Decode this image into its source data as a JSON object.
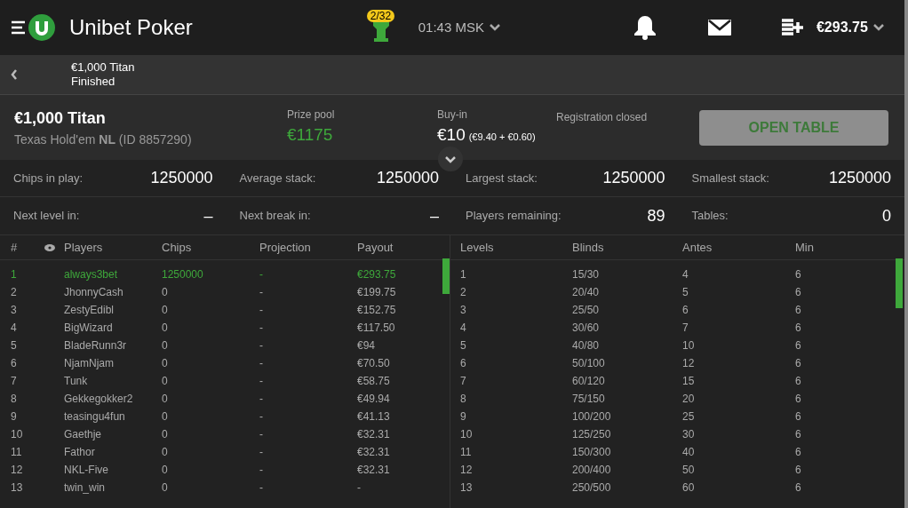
{
  "header": {
    "brand": "Unibet Poker",
    "badge": "2/32",
    "time": "01:43 MSK",
    "balance": "€293.75"
  },
  "subheader": {
    "title": "€1,000 Titan",
    "status": "Finished"
  },
  "tournament": {
    "name": "€1,000 Titan",
    "game": "Texas Hold'em **NL** (ID 8857290)",
    "prize_label": "Prize pool",
    "prize": "€1175",
    "buyin_label": "Buy-in",
    "buyin": "€10",
    "buyin_split": "(€9.40 + €0.60)",
    "registration": "Registration closed",
    "button": "OPEN TABLE"
  },
  "stats": [
    {
      "label": "Chips in play:",
      "value": "1250000"
    },
    {
      "label": "Average stack:",
      "value": "1250000"
    },
    {
      "label": "Largest stack:",
      "value": "1250000"
    },
    {
      "label": "Smallest stack:",
      "value": "1250000"
    },
    {
      "label": "Next level in:",
      "value": "–"
    },
    {
      "label": "Next break in:",
      "value": "–"
    },
    {
      "label": "Players remaining:",
      "value": "89"
    },
    {
      "label": "Tables:",
      "value": "0"
    }
  ],
  "players": {
    "columns": [
      "#",
      "Players",
      "Chips",
      "Projection",
      "Payout"
    ],
    "rows": [
      {
        "rank": "1",
        "name": "always3bet",
        "chips": "1250000",
        "projection": "-",
        "payout": "€293.75",
        "highlighted": true
      },
      {
        "rank": "2",
        "name": "JhonnyCash",
        "chips": "0",
        "projection": "-",
        "payout": "€199.75",
        "highlighted": false
      },
      {
        "rank": "3",
        "name": "ZestyEdibl",
        "chips": "0",
        "projection": "-",
        "payout": "€152.75",
        "highlighted": false
      },
      {
        "rank": "4",
        "name": "BigWizard",
        "chips": "0",
        "projection": "-",
        "payout": "€117.50",
        "highlighted": false
      },
      {
        "rank": "5",
        "name": "BladeRunn3r",
        "chips": "0",
        "projection": "-",
        "payout": "€94",
        "highlighted": false
      },
      {
        "rank": "6",
        "name": "NjamNjam",
        "chips": "0",
        "projection": "-",
        "payout": "€70.50",
        "highlighted": false
      },
      {
        "rank": "7",
        "name": "Tunk",
        "chips": "0",
        "projection": "-",
        "payout": "€58.75",
        "highlighted": false
      },
      {
        "rank": "8",
        "name": "Gekkegokker2",
        "chips": "0",
        "projection": "-",
        "payout": "€49.94",
        "highlighted": false
      },
      {
        "rank": "9",
        "name": "teasingu4fun",
        "chips": "0",
        "projection": "-",
        "payout": "€41.13",
        "highlighted": false
      },
      {
        "rank": "10",
        "name": "Gaethje",
        "chips": "0",
        "projection": "-",
        "payout": "€32.31",
        "highlighted": false
      },
      {
        "rank": "11",
        "name": "Fathor",
        "chips": "0",
        "projection": "-",
        "payout": "€32.31",
        "highlighted": false
      },
      {
        "rank": "12",
        "name": "NKL-Five",
        "chips": "0",
        "projection": "-",
        "payout": "€32.31",
        "highlighted": false
      },
      {
        "rank": "13",
        "name": "twin_win",
        "chips": "0",
        "projection": "-",
        "payout": "-",
        "highlighted": false
      }
    ]
  },
  "levels": {
    "columns": [
      "Levels",
      "Blinds",
      "Antes",
      "Min"
    ],
    "rows": [
      [
        "1",
        "15/30",
        "4",
        "6"
      ],
      [
        "2",
        "20/40",
        "5",
        "6"
      ],
      [
        "3",
        "25/50",
        "6",
        "6"
      ],
      [
        "4",
        "30/60",
        "7",
        "6"
      ],
      [
        "5",
        "40/80",
        "10",
        "6"
      ],
      [
        "6",
        "50/100",
        "12",
        "6"
      ],
      [
        "7",
        "60/120",
        "15",
        "6"
      ],
      [
        "8",
        "75/150",
        "20",
        "6"
      ],
      [
        "9",
        "100/200",
        "25",
        "6"
      ],
      [
        "10",
        "125/250",
        "30",
        "6"
      ],
      [
        "11",
        "150/300",
        "40",
        "6"
      ],
      [
        "12",
        "200/400",
        "50",
        "6"
      ],
      [
        "13",
        "250/500",
        "60",
        "6"
      ]
    ]
  }
}
